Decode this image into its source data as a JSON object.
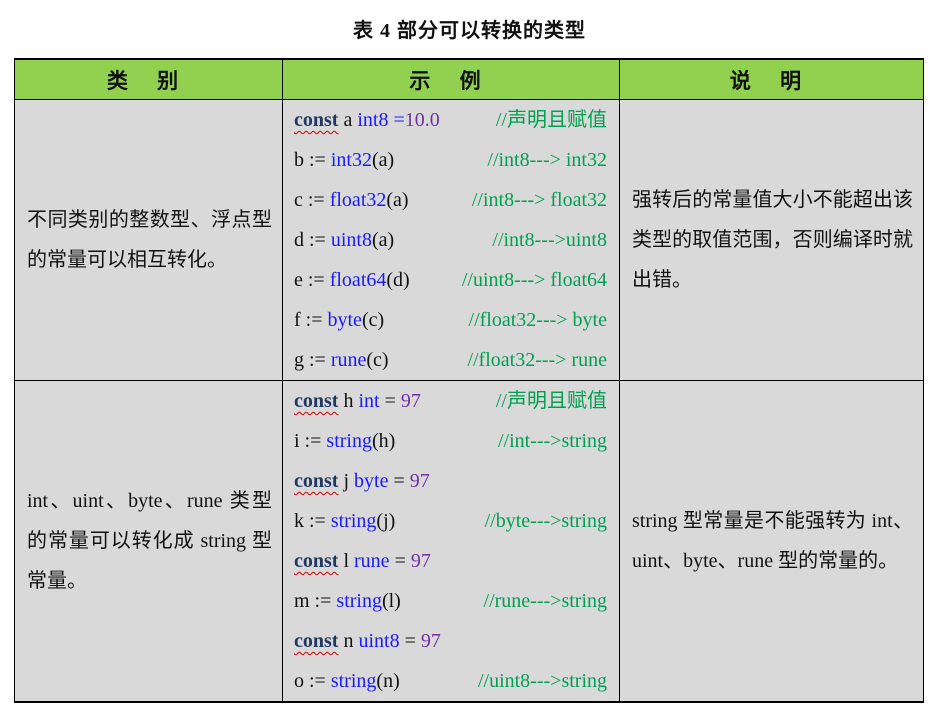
{
  "caption": "表 4  部分可以转换的类型",
  "headers": [
    "类 别",
    "示 例",
    "说 明"
  ],
  "rows": [
    {
      "category": "不同类别的整数型、浮点型的常量可以相互转化。",
      "code": [
        {
          "parts": [
            {
              "t": "const",
              "s": "kw"
            },
            {
              "t": " a ",
              "s": ""
            },
            {
              "t": "int8",
              "s": "ty"
            },
            {
              "t": " =",
              "s": "ty"
            },
            {
              "t": "10.0",
              "s": "num"
            }
          ],
          "comment": "//声明且赋值"
        },
        {
          "parts": [
            {
              "t": "b := ",
              "s": ""
            },
            {
              "t": "int32",
              "s": "ty"
            },
            {
              "t": "(a)",
              "s": ""
            }
          ],
          "comment": "//int8---> int32"
        },
        {
          "parts": [
            {
              "t": "c := ",
              "s": ""
            },
            {
              "t": "float32",
              "s": "ty"
            },
            {
              "t": "(a)",
              "s": ""
            }
          ],
          "comment": "//int8---> float32"
        },
        {
          "parts": [
            {
              "t": "d := ",
              "s": ""
            },
            {
              "t": "uint8",
              "s": "ty"
            },
            {
              "t": "(a)",
              "s": ""
            }
          ],
          "comment": "//int8--->uint8"
        },
        {
          "parts": [
            {
              "t": "e := ",
              "s": ""
            },
            {
              "t": "float64",
              "s": "ty"
            },
            {
              "t": "(d)",
              "s": ""
            }
          ],
          "comment": "//uint8---> float64"
        },
        {
          "parts": [
            {
              "t": "f := ",
              "s": ""
            },
            {
              "t": "byte",
              "s": "ty"
            },
            {
              "t": "(c)",
              "s": ""
            }
          ],
          "comment": "//float32---> byte"
        },
        {
          "parts": [
            {
              "t": "g := ",
              "s": ""
            },
            {
              "t": "rune",
              "s": "ty"
            },
            {
              "t": "(c)",
              "s": ""
            }
          ],
          "comment": "//float32---> rune"
        }
      ],
      "description": "强转后的常量值大小不能超出该类型的取值范围，否则编译时就出错。"
    },
    {
      "category": "int、uint、byte、rune 类型的常量可以转化成 string 型常量。",
      "code": [
        {
          "parts": [
            {
              "t": "const",
              "s": "kw"
            },
            {
              "t": " h ",
              "s": ""
            },
            {
              "t": "int",
              "s": "ty"
            },
            {
              "t": " = ",
              "s": ""
            },
            {
              "t": "97",
              "s": "num"
            }
          ],
          "comment": "//声明且赋值"
        },
        {
          "parts": [
            {
              "t": "i := ",
              "s": ""
            },
            {
              "t": "string",
              "s": "ty"
            },
            {
              "t": "(h)",
              "s": ""
            }
          ],
          "comment": "//int--->string"
        },
        {
          "parts": [
            {
              "t": "const",
              "s": "kw"
            },
            {
              "t": " j ",
              "s": ""
            },
            {
              "t": "byte",
              "s": "ty"
            },
            {
              "t": " = ",
              "s": ""
            },
            {
              "t": "97",
              "s": "num"
            }
          ],
          "comment": ""
        },
        {
          "parts": [
            {
              "t": "k := ",
              "s": ""
            },
            {
              "t": "string",
              "s": "ty"
            },
            {
              "t": "(j)",
              "s": ""
            }
          ],
          "comment": "//byte--->string"
        },
        {
          "parts": [
            {
              "t": "const",
              "s": "kw"
            },
            {
              "t": " l ",
              "s": ""
            },
            {
              "t": "rune",
              "s": "ty"
            },
            {
              "t": " = ",
              "s": ""
            },
            {
              "t": "97",
              "s": "num"
            }
          ],
          "comment": ""
        },
        {
          "parts": [
            {
              "t": "m := ",
              "s": ""
            },
            {
              "t": "string",
              "s": "ty"
            },
            {
              "t": "(l)",
              "s": ""
            }
          ],
          "comment": "//rune--->string"
        },
        {
          "parts": [
            {
              "t": "const",
              "s": "kw"
            },
            {
              "t": " n ",
              "s": ""
            },
            {
              "t": "uint8",
              "s": "ty"
            },
            {
              "t": " = ",
              "s": ""
            },
            {
              "t": "97",
              "s": "num"
            }
          ],
          "comment": ""
        },
        {
          "parts": [
            {
              "t": "o := ",
              "s": ""
            },
            {
              "t": "string",
              "s": "ty"
            },
            {
              "t": "(n)",
              "s": ""
            }
          ],
          "comment": "//uint8--->string"
        }
      ],
      "description": "string 型常量是不能强转为 int、uint、byte、rune 型的常量的。"
    }
  ]
}
